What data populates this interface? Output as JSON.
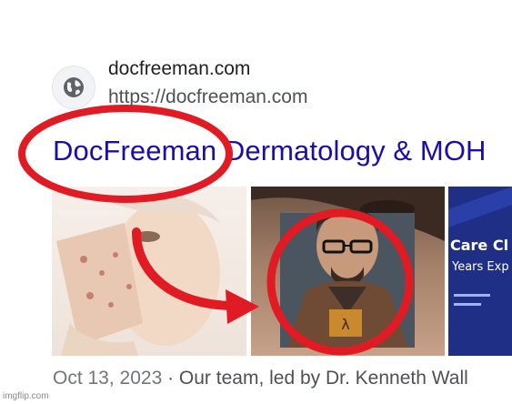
{
  "result": {
    "site_name": "docfreeman.com",
    "url": "https://docfreeman.com",
    "title": "DocFreeman Dermatology & MOH",
    "snippet_date": "Oct 13, 2023",
    "snippet_separator": " · ",
    "snippet_text": "Our team, led by Dr. Kenneth Wall",
    "favicon_icon": "globe-icon"
  },
  "thumbnails": [
    {
      "subject": "woman holding a mask showing acne skin"
    },
    {
      "subject": "close-up face photo with a bearded man with glasses inset"
    },
    {
      "banner_text_line1": "Care Cl",
      "banner_text_line2": "Years Exp"
    }
  ],
  "annotations": {
    "circle_color": "#e01b24",
    "arrow_color": "#e01b24",
    "inset_icon": "lambda-chest-badge"
  },
  "watermark": "imgflip.com",
  "colors": {
    "title_link": "#1a0dab",
    "url_text": "#4d5156",
    "banner_blue": "#1f2f86"
  }
}
